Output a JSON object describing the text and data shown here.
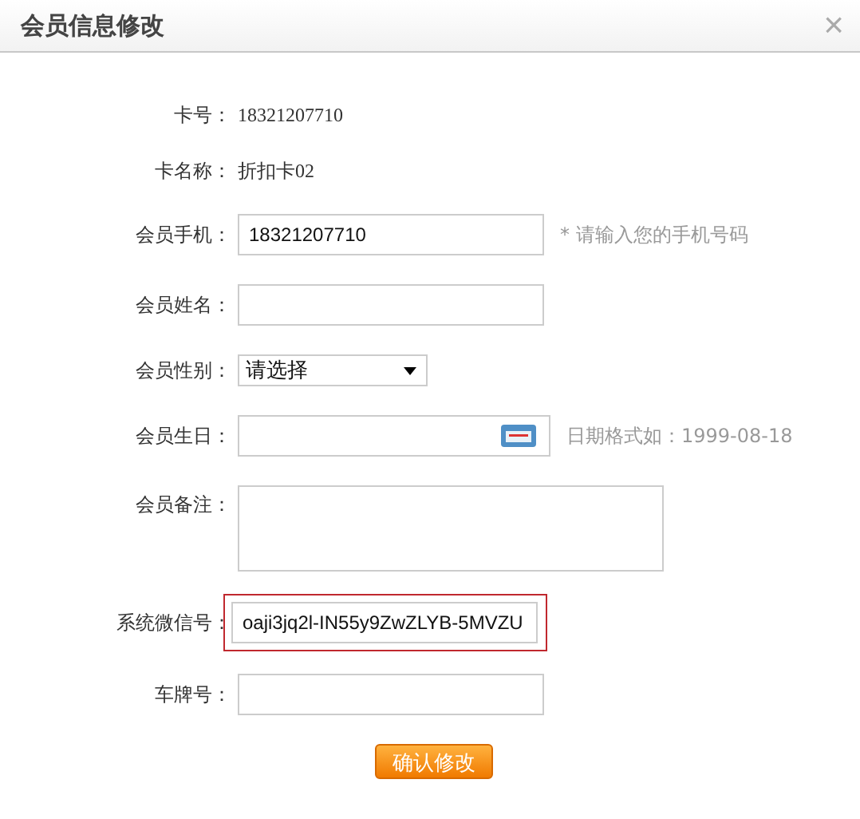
{
  "dialog": {
    "title": "会员信息修改",
    "close": "×"
  },
  "fields": [
    {
      "kind": "text",
      "label": "卡号：",
      "value": "18321207710"
    },
    {
      "kind": "text",
      "label": "卡名称：",
      "value": "折扣卡02"
    },
    {
      "kind": "input",
      "label": "会员手机：",
      "value": "18321207710",
      "hint": "* 请输入您的手机号码"
    },
    {
      "kind": "input",
      "label": "会员姓名："
    },
    {
      "kind": "select",
      "label": "会员性别：",
      "value": "请选择"
    },
    {
      "kind": "date",
      "label": "会员生日：",
      "hint": "日期格式如：1999-08-18"
    },
    {
      "kind": "textarea",
      "label": "会员备注："
    },
    {
      "kind": "input",
      "label": "系统微信号：",
      "value": "oaji3jq2l-IN55y9ZwZLYB-5MVZU",
      "highlighted": true
    },
    {
      "kind": "input",
      "label": "车牌号："
    }
  ],
  "submit": "确认修改"
}
